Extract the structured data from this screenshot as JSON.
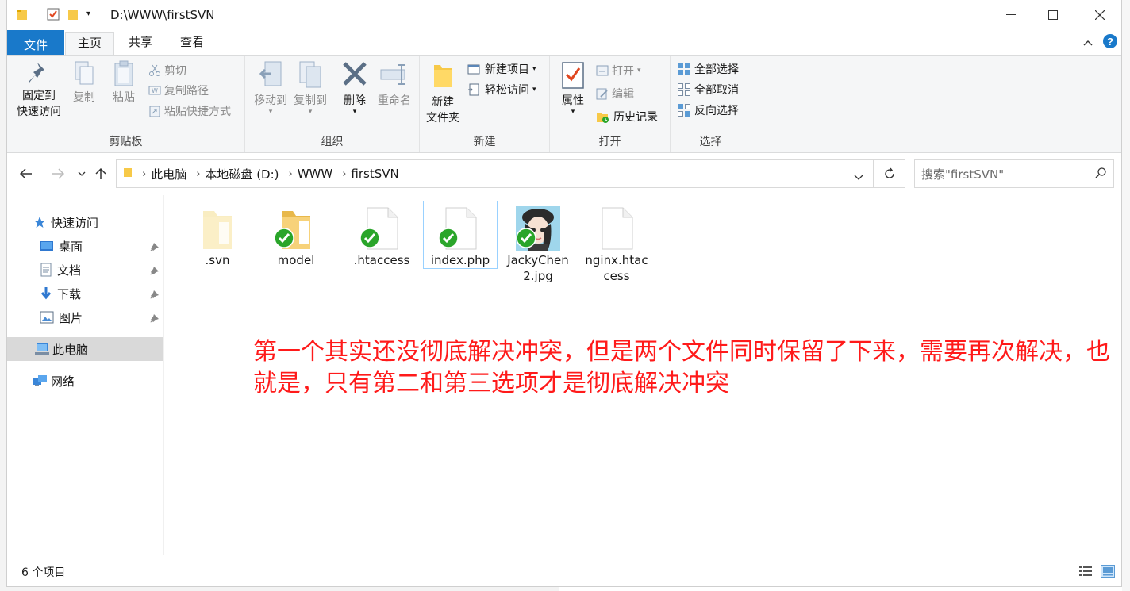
{
  "window": {
    "title": "D:\\WWW\\firstSVN"
  },
  "tabs": [
    {
      "label": "文件"
    },
    {
      "label": "主页"
    },
    {
      "label": "共享"
    },
    {
      "label": "查看"
    }
  ],
  "ribbon": {
    "clipboard": {
      "label": "剪贴板",
      "pin_line1": "固定到",
      "pin_line2": "快速访问",
      "copy": "复制",
      "paste": "粘贴",
      "cut": "剪切",
      "copy_path": "复制路径",
      "paste_shortcut": "粘贴快捷方式"
    },
    "organize": {
      "label": "组织",
      "move_to": "移动到",
      "copy_to": "复制到",
      "delete": "删除",
      "rename": "重命名"
    },
    "new": {
      "label": "新建",
      "new_folder_line1": "新建",
      "new_folder_line2": "文件夹",
      "new_item": "新建项目",
      "easy_access": "轻松访问"
    },
    "open": {
      "label": "打开",
      "properties": "属性",
      "open": "打开",
      "edit": "编辑",
      "history": "历史记录"
    },
    "select": {
      "label": "选择",
      "select_all": "全部选择",
      "select_none": "全部取消",
      "invert": "反向选择"
    }
  },
  "breadcrumb": [
    "此电脑",
    "本地磁盘 (D:)",
    "WWW",
    "firstSVN"
  ],
  "search": {
    "placeholder": "搜索\"firstSVN\""
  },
  "nav": {
    "quick_access": "快速访问",
    "desktop": "桌面",
    "documents": "文档",
    "downloads": "下载",
    "pictures": "图片",
    "this_pc": "此电脑",
    "network": "网络"
  },
  "files": [
    {
      "name": ".svn",
      "type": "folder-hidden",
      "badge": "none"
    },
    {
      "name": "model",
      "type": "folder",
      "badge": "check-green"
    },
    {
      "name": ".htaccess",
      "type": "file",
      "badge": "check-green"
    },
    {
      "name": "index.php",
      "type": "file",
      "badge": "check-green",
      "selected": true
    },
    {
      "name": "JackyChen2.jpg",
      "type": "image",
      "badge": "check-green"
    },
    {
      "name": "nginx.htaccess",
      "type": "file",
      "badge": "none"
    }
  ],
  "annotation": "第一个其实还没彻底解决冲突，但是两个文件同时保留了下来，需要再次解决，也就是，只有第二和第三选项才是彻底解决冲突",
  "status": {
    "item_count": "6 个项目"
  },
  "colors": {
    "accent": "#1979ca",
    "annotation": "#ff1a1a",
    "svn_ok": "#2aa52a"
  }
}
